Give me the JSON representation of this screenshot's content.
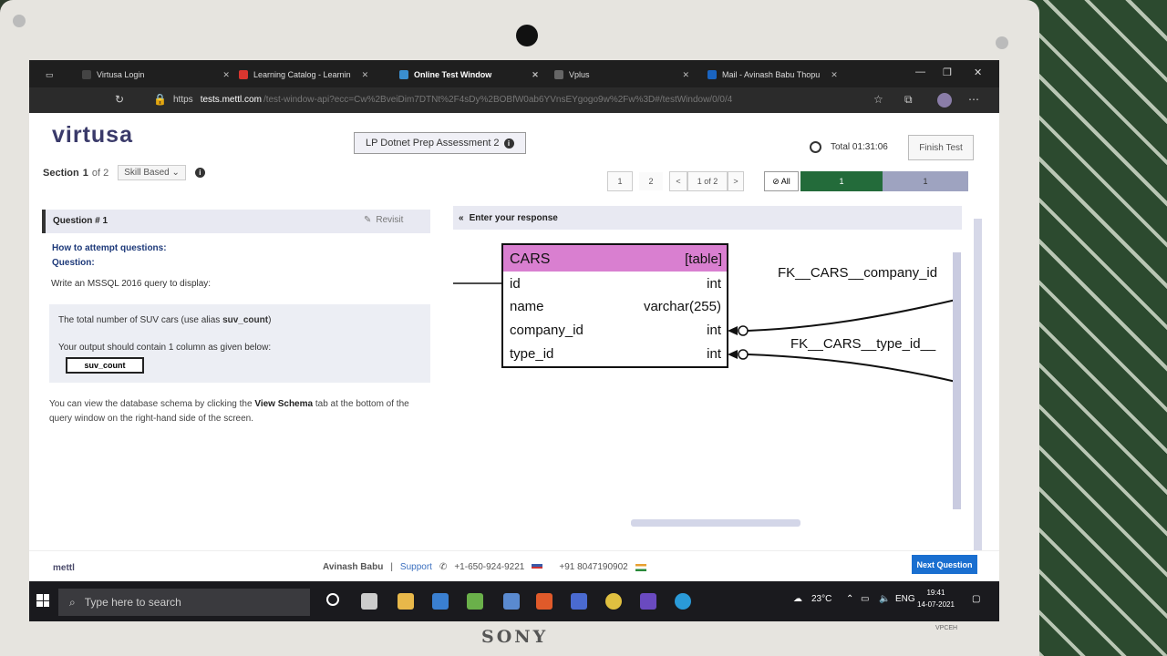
{
  "device": {
    "brand": "SONY",
    "model_label": "VPCEH"
  },
  "browser": {
    "tabs": [
      {
        "label": "Virtusa Login",
        "active": false
      },
      {
        "label": "Learning Catalog - Learnin",
        "active": false
      },
      {
        "label": "Online Test Window",
        "active": true
      },
      {
        "label": "Vplus",
        "active": false
      },
      {
        "label": "Mail - Avinash Babu Thopu",
        "active": false
      }
    ],
    "url_protocol": "https",
    "url_host": "tests.mettl.com",
    "url_path": "/test-window-api?ecc=Cw%2BveiDim7DTNt%2F4sDy%2BOBfW0ab6YVnsEYgogo9w%2Fw%3D#/testWindow/0/0/4"
  },
  "header": {
    "logo": "virtusa",
    "assessment_title": "LP Dotnet Prep Assessment 2",
    "timer_label": "Total 01:31:06",
    "finish_button": "Finish Test"
  },
  "nav": {
    "section_label": "Section",
    "section_current": "1",
    "section_of": "of 2",
    "section_type": "Skill Based",
    "pages": [
      "1",
      "2"
    ],
    "prev": "<",
    "page_of": "1 of 2",
    "next": ">",
    "filter_all": "All",
    "status_answered": "1",
    "status_unanswered": "1"
  },
  "question": {
    "title": "Question # 1",
    "revisit_label": "Revisit",
    "howto_label": "How to attempt questions:",
    "question_label": "Question:",
    "prompt": "Write an MSSQL 2016 query to display:",
    "requirement_pre": "The total number of SUV cars (use alias ",
    "requirement_alias": "suv_count",
    "requirement_post": ")",
    "output_note": "Your output should contain 1 column as given below:",
    "output_column": "suv_count",
    "schema_note_pre": "You can view the database schema by clicking the ",
    "schema_note_bold": "View Schema",
    "schema_note_post": " tab at the bottom of the query window on the right-hand side of the screen."
  },
  "response": {
    "header": "Enter your response",
    "table": {
      "name": "CARS",
      "tag": "[table]",
      "header_color": "#d97fd0",
      "columns": [
        {
          "name": "id",
          "type": "int"
        },
        {
          "name": "name",
          "type": "varchar(255)"
        },
        {
          "name": "company_id",
          "type": "int"
        },
        {
          "name": "type_id",
          "type": "int"
        }
      ]
    },
    "fk_labels": [
      "FK__CARS__company_id",
      "FK__CARS__type_id__"
    ]
  },
  "footer": {
    "brand": "mettl",
    "user": "Avinash Babu",
    "support_label": "Support",
    "phone_us": "+1-650-924-9221",
    "phone_in": "+91 8047190902",
    "next_button": "Next Question"
  },
  "taskbar": {
    "search_placeholder": "Type here to search",
    "weather": "23°C",
    "language": "ENG",
    "time": "19:41",
    "date": "14-07-2021"
  },
  "colors": {
    "progress_answered": "#236b3a",
    "progress_unanswered": "#9ea3c0",
    "primary_button": "#1a6fd0",
    "brand_text": "#3a3a6a"
  }
}
